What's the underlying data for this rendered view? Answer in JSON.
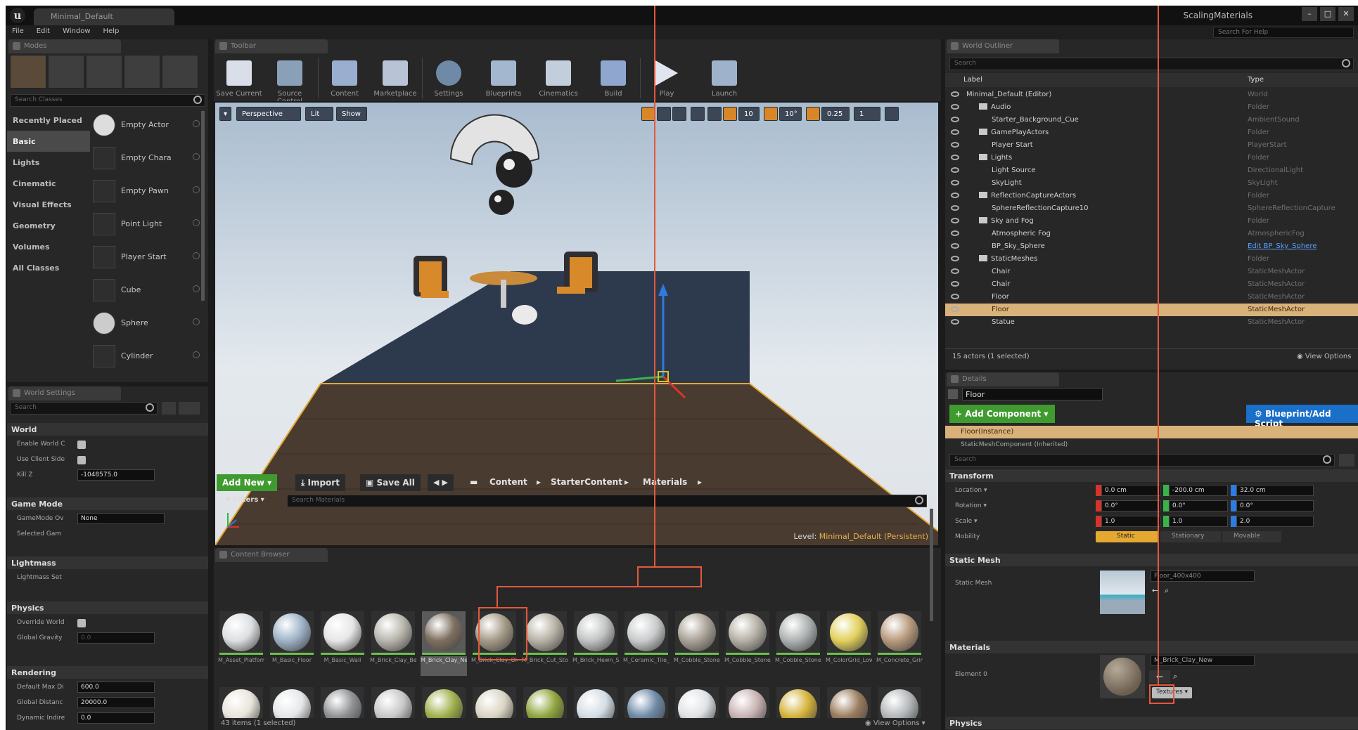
{
  "window": {
    "logo": "u",
    "doc_tab": "Minimal_Default",
    "title": "ScalingMaterials",
    "minimize": "–",
    "maximize": "□",
    "close": "✕",
    "help_placeholder": "Search For Help"
  },
  "menu": [
    "File",
    "Edit",
    "Window",
    "Help"
  ],
  "modes": {
    "tab": "Modes",
    "search_placeholder": "Search Classes",
    "categories": [
      "Recently Placed",
      "Basic",
      "Lights",
      "Cinematic",
      "Visual Effects",
      "Geometry",
      "Volumes",
      "All Classes"
    ],
    "selected_category": "Basic",
    "items": [
      "Empty Actor",
      "Empty Chara",
      "Empty Pawn",
      "Point Light",
      "Player Start",
      "Cube",
      "Sphere",
      "Cylinder"
    ]
  },
  "world_settings": {
    "tab": "World Settings",
    "search_placeholder": "Search",
    "sections": [
      {
        "name": "World",
        "props": [
          {
            "label": "Enable World C",
            "type": "check"
          },
          {
            "label": "Use Client Side",
            "type": "check"
          },
          {
            "label": "Kill Z",
            "type": "value",
            "value": "-1048575.0"
          }
        ]
      },
      {
        "name": "Game Mode",
        "props": [
          {
            "label": "GameMode Ov",
            "type": "select",
            "value": "None"
          },
          {
            "label": "Selected Gam",
            "type": "text"
          }
        ]
      },
      {
        "name": "Lightmass",
        "props": [
          {
            "label": "Lightmass Set",
            "type": "text"
          }
        ]
      },
      {
        "name": "Physics",
        "props": [
          {
            "label": "Override World",
            "type": "check"
          },
          {
            "label": "Global Gravity",
            "type": "value",
            "value": "0.0"
          }
        ]
      },
      {
        "name": "Rendering",
        "props": [
          {
            "label": "Default Max Di",
            "type": "value",
            "value": "600.0"
          },
          {
            "label": "Global Distanc",
            "type": "value",
            "value": "20000.0"
          },
          {
            "label": "Dynamic Indire",
            "type": "value",
            "value": "0.0"
          }
        ]
      }
    ]
  },
  "toolbar": {
    "tab": "Toolbar",
    "buttons": [
      "Save Current",
      "Source Control",
      "Content",
      "Marketplace",
      "Settings",
      "Blueprints",
      "Cinematics",
      "Build",
      "Play",
      "Launch"
    ]
  },
  "viewport": {
    "perspective": "Perspective",
    "lit": "Lit",
    "show": "Show",
    "grid_snap": "10",
    "rot_snap": "10°",
    "scale_snap": "0.25",
    "camera_speed": "1",
    "level_prefix": "Level:",
    "level_name": "Minimal_Default (Persistent)"
  },
  "content_browser": {
    "tab": "Content Browser",
    "add_new": "Add New",
    "import": "Import",
    "save_all": "Save All",
    "path": [
      "Content",
      "StarterContent",
      "Materials"
    ],
    "filters": "Filters",
    "search_placeholder": "Search Materials",
    "status": "43 items (1 selected)",
    "view_options": "View Options",
    "assets": [
      {
        "name": "M_Asset_Platform",
        "color": "#dcdfe1"
      },
      {
        "name": "M_Basic_Floor",
        "color": "#9fb3c8"
      },
      {
        "name": "M_Basic_Wall",
        "color": "#e6e6e6"
      },
      {
        "name": "M_Brick_Clay_Beveled",
        "color": "#b9b6ad"
      },
      {
        "name": "M_Brick_Clay_New",
        "color": "#7d6f60"
      },
      {
        "name": "M_Brick_Clay_Old",
        "color": "#a59a88"
      },
      {
        "name": "M_Brick_Cut_Stone",
        "color": "#b8b2a6"
      },
      {
        "name": "M_Brick_Hewn_Stone",
        "color": "#c2c4c4"
      },
      {
        "name": "M_Ceramic_Tile_Checker",
        "color": "#c9cbcc"
      },
      {
        "name": "M_Cobble_Stone_Pebble",
        "color": "#a9a296"
      },
      {
        "name": "M_Cobble_Stone_Rough",
        "color": "#b5b0a5"
      },
      {
        "name": "M_Cobble_Stone_Smooth",
        "color": "#aeb2b2"
      },
      {
        "name": "M_ColorGrid_LowSpec",
        "color": "#e2d05c"
      },
      {
        "name": "M_Concrete_Grime",
        "color": "#b89a7c"
      }
    ],
    "row2_colors": [
      "#e8e4db",
      "#e4e7ea",
      "#8f9295",
      "#c8c8c8",
      "#9fb04c",
      "#d9d3c2",
      "#8fa53d",
      "#d3dde4",
      "#6d8aa6",
      "#dfe2e5",
      "#c9b2b2",
      "#d4b23a",
      "#9a7c5d",
      "#b4b8bb"
    ]
  },
  "outliner": {
    "tab": "World Outliner",
    "search_placeholder": "Search",
    "col_label": "Label",
    "col_type": "Type",
    "rows": [
      {
        "label": "Minimal_Default (Editor)",
        "type": "World",
        "depth": 0,
        "folder": false
      },
      {
        "label": "Audio",
        "type": "Folder",
        "depth": 1,
        "folder": true
      },
      {
        "label": "Starter_Background_Cue",
        "type": "AmbientSound",
        "depth": 2,
        "folder": false
      },
      {
        "label": "GamePlayActors",
        "type": "Folder",
        "depth": 1,
        "folder": true
      },
      {
        "label": "Player Start",
        "type": "PlayerStart",
        "depth": 2,
        "folder": false
      },
      {
        "label": "Lights",
        "type": "Folder",
        "depth": 1,
        "folder": true
      },
      {
        "label": "Light Source",
        "type": "DirectionalLight",
        "depth": 2,
        "folder": false
      },
      {
        "label": "SkyLight",
        "type": "SkyLight",
        "depth": 2,
        "folder": false
      },
      {
        "label": "ReflectionCaptureActors",
        "type": "Folder",
        "depth": 1,
        "folder": true
      },
      {
        "label": "SphereReflectionCapture10",
        "type": "SphereReflectionCapture",
        "depth": 2,
        "folder": false
      },
      {
        "label": "Sky and Fog",
        "type": "Folder",
        "depth": 1,
        "folder": true
      },
      {
        "label": "Atmospheric Fog",
        "type": "AtmosphericFog",
        "depth": 2,
        "folder": false
      },
      {
        "label": "BP_Sky_Sphere",
        "type": "Edit BP_Sky_Sphere",
        "depth": 2,
        "folder": false
      },
      {
        "label": "StaticMeshes",
        "type": "Folder",
        "depth": 1,
        "folder": true
      },
      {
        "label": "Chair",
        "type": "StaticMeshActor",
        "depth": 2,
        "folder": false
      },
      {
        "label": "Chair",
        "type": "StaticMeshActor",
        "depth": 2,
        "folder": false
      },
      {
        "label": "Floor",
        "type": "StaticMeshActor",
        "depth": 2,
        "folder": false
      },
      {
        "label": "Floor",
        "type": "StaticMeshActor",
        "depth": 2,
        "folder": false
      },
      {
        "label": "Statue",
        "type": "StaticMeshActor",
        "depth": 2,
        "folder": false
      }
    ],
    "selected_index": 17,
    "status": "15 actors (1 selected)",
    "view_options": "View Options"
  },
  "details": {
    "tab": "Details",
    "name": "Floor",
    "add_component": "+ Add Component",
    "blueprint_btn": "Blueprint/Add Script",
    "instance": "Floor(Instance)",
    "component": "StaticMeshComponent (Inherited)",
    "search_placeholder": "Search",
    "transform_label": "Transform",
    "location_label": "Location",
    "location": [
      "0.0 cm",
      "-200.0 cm",
      "32.0 cm"
    ],
    "rotation_label": "Rotation",
    "rotation": [
      "0.0°",
      "0.0°",
      "0.0°"
    ],
    "scale_label": "Scale",
    "scale": [
      "1.0",
      "1.0",
      "2.0"
    ],
    "mobility_label": "Mobility",
    "mobility": [
      "Static",
      "Stationary",
      "Movable"
    ],
    "static_mesh_section": "Static Mesh",
    "static_mesh_label": "Static Mesh",
    "static_mesh_value": "Floor_400x400",
    "materials_section": "Materials",
    "element_label": "Element 0",
    "material_value": "M_Brick_Clay_New",
    "textures_btn": "Textures",
    "physics_section": "Physics"
  },
  "colors": {
    "highlight": "#e3593a",
    "selection": "#d9b27a",
    "green": "#3f9b2f",
    "blue": "#1a6fc9"
  }
}
